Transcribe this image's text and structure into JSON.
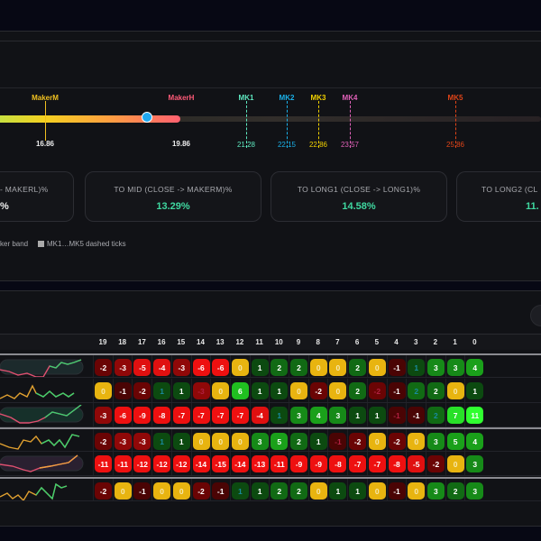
{
  "markers": {
    "maker_m": {
      "label": "MakerM",
      "value": "16.86",
      "color": "#f0c020"
    },
    "maker_h": {
      "label": "MakerH",
      "value": "19.86",
      "color": "#ff5a78"
    },
    "mk": [
      {
        "label": "MK1",
        "value": "21.28",
        "color": "#5ee8c0"
      },
      {
        "label": "MK2",
        "value": "22.15",
        "color": "#1ab0e8"
      },
      {
        "label": "MK3",
        "value": "22.86",
        "color": "#f0d000"
      },
      {
        "label": "MK4",
        "value": "23.57",
        "color": "#e060b8"
      },
      {
        "label": "MK5",
        "value": "25.86",
        "color": "#e04418"
      }
    ]
  },
  "cards": [
    {
      "label": "- MAKERL)%",
      "value": "%"
    },
    {
      "label": "TO MID (CLOSE -> MAKERM)%",
      "value": "13.29%"
    },
    {
      "label": "TO LONG1 (CLOSE -> LONG1)%",
      "value": "14.58%"
    },
    {
      "label": "TO LONG2 (CL",
      "value": "11."
    }
  ],
  "legend": {
    "band": "ker band",
    "ticks": "MK1…MK5 dashed ticks"
  },
  "table": {
    "columns": [
      "19",
      "18",
      "17",
      "16",
      "15",
      "14",
      "13",
      "12",
      "11",
      "10",
      "9",
      "8",
      "7",
      "6",
      "5",
      "4",
      "3",
      "2",
      "1",
      "0"
    ],
    "rows": [
      {
        "cells": [
          -2,
          -3,
          -5,
          -4,
          -3,
          -6,
          -6,
          0,
          1,
          2,
          2,
          0,
          0,
          2,
          0,
          -1,
          1,
          3,
          3,
          4
        ],
        "dim": [
          16
        ]
      },
      {
        "cells": [
          0,
          -1,
          -2,
          1,
          1,
          -3,
          0,
          6,
          1,
          1,
          0,
          -2,
          0,
          2,
          -2,
          -1,
          2,
          2,
          0,
          1
        ],
        "dim": [
          3,
          5,
          14,
          16
        ]
      },
      {
        "cells": [
          -3,
          -6,
          -9,
          -8,
          -7,
          -7,
          -7,
          -7,
          -4,
          1,
          3,
          4,
          3,
          1,
          1,
          -1,
          -1,
          2,
          7,
          11
        ],
        "dim": [
          9,
          15,
          17
        ]
      },
      {
        "cells": [
          -2,
          -3,
          -3,
          1,
          1,
          0,
          0,
          0,
          3,
          5,
          2,
          1,
          -1,
          -2,
          0,
          -2,
          0,
          3,
          5,
          4
        ],
        "dim": [
          3,
          12
        ]
      },
      {
        "cells": [
          -11,
          -11,
          -12,
          -12,
          -12,
          -14,
          -15,
          -14,
          -13,
          -11,
          -9,
          -9,
          -8,
          -7,
          -7,
          -8,
          -5,
          -2,
          0,
          3
        ],
        "dim": []
      },
      {
        "cells": [
          -2,
          0,
          -1,
          0,
          0,
          -2,
          -1,
          1,
          1,
          2,
          2,
          0,
          1,
          1,
          0,
          -1,
          0,
          3,
          2,
          3
        ],
        "dim": [
          7,
          16
        ]
      }
    ]
  }
}
